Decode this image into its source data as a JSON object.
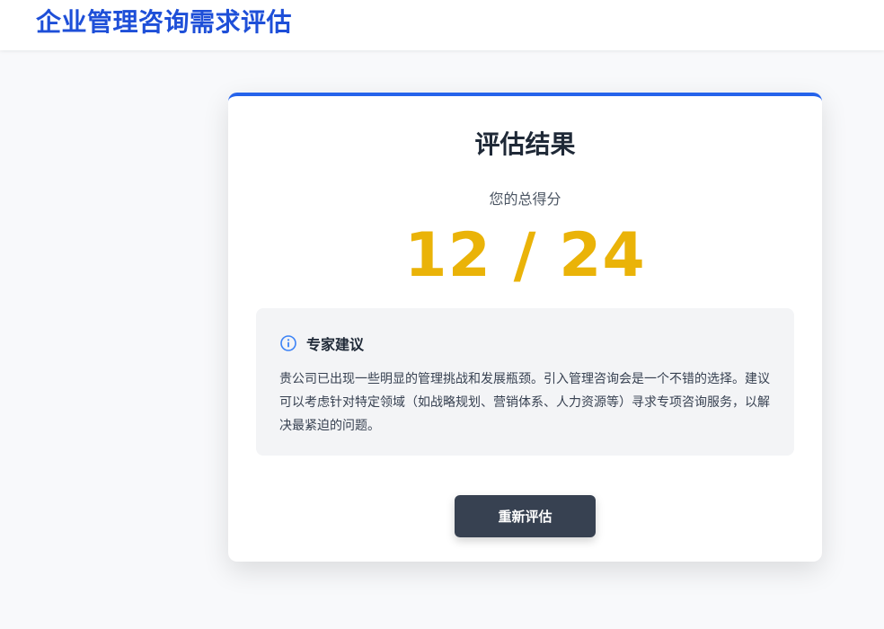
{
  "header": {
    "title": "企业管理咨询需求评估"
  },
  "result": {
    "title": "评估结果",
    "score_label": "您的总得分",
    "score": "12 / 24",
    "score_value": 12,
    "score_max": 24
  },
  "advice": {
    "icon": "info-icon",
    "title": "专家建议",
    "text": "贵公司已出现一些明显的管理挑战和发展瓶颈。引入管理咨询会是一个不错的选择。建议可以考虑针对特定领域（如战略规划、营销体系、人力资源等）寻求专项咨询服务，以解决最紧迫的问题。"
  },
  "actions": {
    "retry_label": "重新评估"
  },
  "colors": {
    "brand": "#1e4fd8",
    "accent_border": "#2563eb",
    "score": "#eab308",
    "button": "#374151",
    "advice_bg": "#f3f4f6"
  }
}
